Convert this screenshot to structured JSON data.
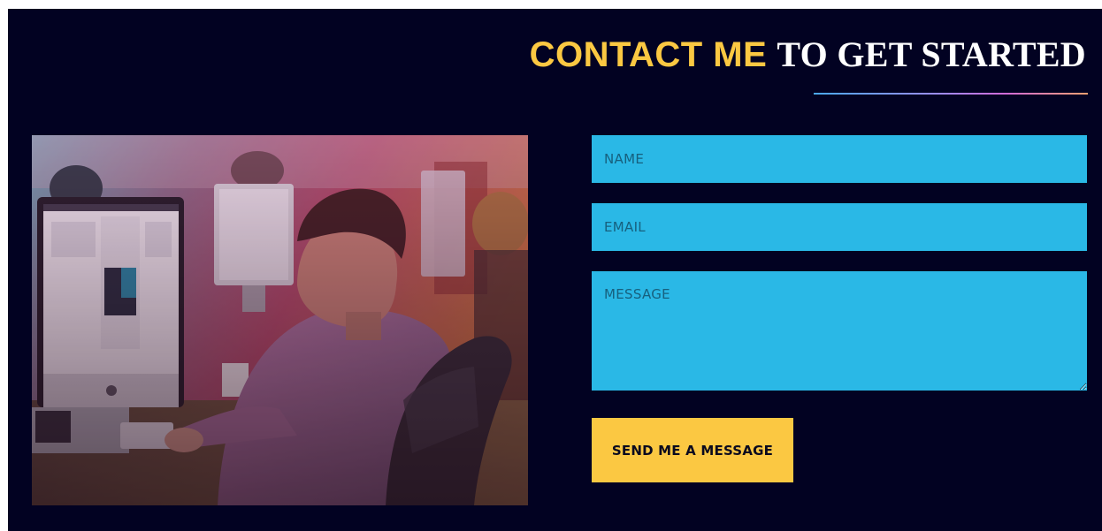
{
  "heading": {
    "accent": "CONTACT ME",
    "rest": "TO GET STARTED"
  },
  "form": {
    "name_placeholder": "NAME",
    "email_placeholder": "EMAIL",
    "message_placeholder": "MESSAGE",
    "submit_label": "SEND ME A MESSAGE"
  },
  "colors": {
    "background": "#020222",
    "accent_yellow": "#fbc842",
    "field_blue": "#2ab8e6"
  }
}
